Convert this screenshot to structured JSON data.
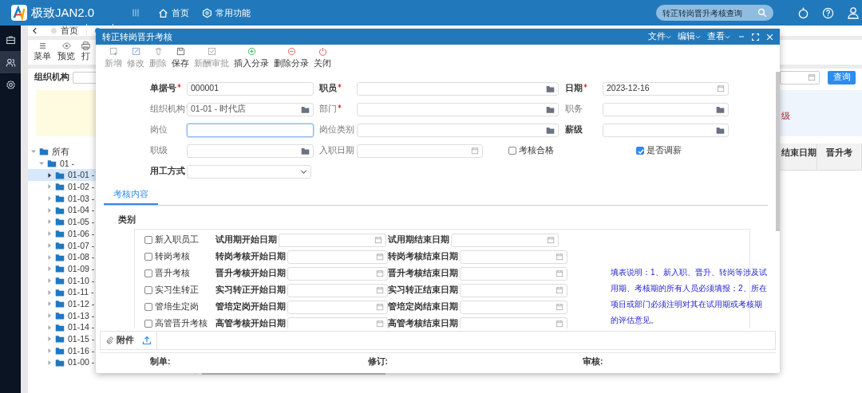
{
  "app": {
    "title": "极致JAN2.0",
    "nav": [
      {
        "label": "首页"
      },
      {
        "label": "常用功能"
      }
    ],
    "search": {
      "value": "转正转岗晋升考核查询"
    }
  },
  "sidebar": {
    "items": [
      {
        "selected": false
      },
      {
        "selected": true
      },
      {
        "selected": false
      }
    ]
  },
  "page_tabs": [
    {
      "label": "首页",
      "selected": false
    },
    {
      "selected": true
    }
  ],
  "page_toolbar": [
    {
      "label": "菜单"
    },
    {
      "label": "预览"
    },
    {
      "label": "打"
    }
  ],
  "filter": {
    "label": "组织机构",
    "query_button": "查询"
  },
  "tree": [
    {
      "label": "所有",
      "expanded": true,
      "selected": false,
      "children": [
        {
          "label": "01 -",
          "expanded": true,
          "selected": false,
          "children": [
            {
              "label": "01-01 -",
              "expanded": false,
              "selected": true
            },
            {
              "label": "01-02 -",
              "expanded": false,
              "selected": false
            },
            {
              "label": "01-03 -",
              "expanded": false,
              "selected": false
            },
            {
              "label": "01-04 -",
              "expanded": false,
              "selected": false
            },
            {
              "label": "01-05 -",
              "expanded": false,
              "selected": false
            },
            {
              "label": "01-06 -",
              "expanded": false,
              "selected": false
            },
            {
              "label": "01-07 -",
              "expanded": false,
              "selected": false
            },
            {
              "label": "01-08 -",
              "expanded": false,
              "selected": false
            },
            {
              "label": "01-09 -",
              "expanded": false,
              "selected": false
            },
            {
              "label": "01-10 -",
              "expanded": false,
              "selected": false
            },
            {
              "label": "01-11 -",
              "expanded": false,
              "selected": false
            },
            {
              "label": "01-12 -",
              "expanded": false,
              "selected": false
            },
            {
              "label": "01-13 -",
              "expanded": false,
              "selected": false
            },
            {
              "label": "01-14 -",
              "expanded": false,
              "selected": false
            },
            {
              "label": "01-15 -",
              "expanded": false,
              "selected": false
            },
            {
              "label": "01-16 -",
              "expanded": false,
              "selected": false
            },
            {
              "label": "01-00 -",
              "expanded": false,
              "selected": false
            }
          ]
        }
      ]
    }
  ],
  "info_panel": {
    "text": "级"
  },
  "table": {
    "columns": [
      "结束日期",
      "晋升考"
    ]
  },
  "dialog": {
    "title": "转正转岗晋升考核",
    "menus": [
      "文件",
      "编辑",
      "查看"
    ],
    "toolbar": [
      {
        "label": "新增",
        "disabled": true
      },
      {
        "label": "修改",
        "disabled": true
      },
      {
        "label": "删除",
        "disabled": true
      },
      {
        "label": "保存",
        "disabled": false
      },
      {
        "label": "新酬审批",
        "disabled": true
      },
      {
        "label": "插入分录",
        "disabled": false
      },
      {
        "label": "删除分录",
        "disabled": false
      },
      {
        "label": "关闭",
        "disabled": false
      }
    ],
    "form": [
      [
        {
          "label": "单据号",
          "required": true,
          "bold": true,
          "kind": "text",
          "value": "000001",
          "focused": false
        },
        {
          "label": "职员",
          "required": true,
          "bold": true,
          "kind": "lookup",
          "focused": false
        },
        {
          "label": "日期",
          "required": true,
          "bold": true,
          "kind": "date",
          "value": "2023-12-16",
          "focused": false
        }
      ],
      [
        {
          "label": "组织机构",
          "required": true,
          "bold": false,
          "kind": "lookup",
          "value": "01-01 - 时代店",
          "focused": false
        },
        {
          "label": "部门",
          "required": true,
          "bold": false,
          "kind": "lookup",
          "focused": false
        },
        {
          "label": "职务",
          "required": false,
          "bold": false,
          "kind": "lookup",
          "focused": false
        }
      ],
      [
        {
          "label": "岗位",
          "required": false,
          "bold": false,
          "kind": "text",
          "focused": true
        },
        {
          "label": "岗位类别",
          "required": false,
          "bold": false,
          "kind": "lookup",
          "focused": false
        },
        {
          "label": "薪级",
          "required": false,
          "bold": true,
          "kind": "lookup",
          "focused": false
        }
      ],
      [
        {
          "label": "职级",
          "required": false,
          "bold": false,
          "kind": "lookup",
          "focused": false
        },
        {
          "label": "入职日期",
          "required": false,
          "bold": false,
          "kind": "date",
          "focused": false
        },
        {
          "label": "考核合格",
          "kind": "checkbox",
          "checked": false
        },
        {
          "label": "是否调薪",
          "kind": "checkbox",
          "checked": true
        }
      ],
      [
        {
          "label": "用工方式",
          "required": false,
          "bold": true,
          "kind": "select",
          "focused": false
        }
      ]
    ],
    "tabs": [
      {
        "label": "考核内容",
        "selected": true
      }
    ],
    "category_label": "类别",
    "categories": [
      {
        "label": "新入职员工",
        "checked": false,
        "start_label": "试用期开始日期",
        "end_label": "试用期结束日期"
      },
      {
        "label": "转岗考核",
        "checked": false,
        "start_label": "转岗考核开始日期",
        "end_label": "转岗考核结束日期"
      },
      {
        "label": "晋升考核",
        "checked": false,
        "start_label": "晋升考核开始日期",
        "end_label": "晋升考核结束日期"
      },
      {
        "label": "实习生转正",
        "checked": false,
        "start_label": "实习转正开始日期",
        "end_label": "实习转正结束日期"
      },
      {
        "label": "管培生定岗",
        "checked": false,
        "start_label": "管培定岗开始日期",
        "end_label": "管培定岗结束日期"
      },
      {
        "label": "高管晋升考核",
        "checked": false,
        "start_label": "高管考核开始日期",
        "end_label": "高管考核结束日期"
      }
    ],
    "note": "填表说明：1、新入职、晋升、转岗等涉及试用期、考核期的所有人员必须填报；2、所在项目或部门必须注明对其在试用期或考核期的评估意见。",
    "attachments": {
      "label": "附件"
    },
    "footer": [
      "制单:",
      "修订:",
      "审核:"
    ]
  }
}
